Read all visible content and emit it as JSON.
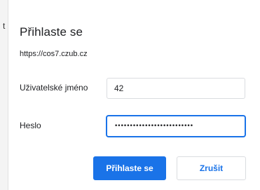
{
  "dialog": {
    "title": "Přihlaste se",
    "url": "https://cos7.czub.cz",
    "stray_mark": "t",
    "username": {
      "label": "Uživatelské jméno",
      "value": "42"
    },
    "password": {
      "label": "Heslo",
      "masked_value": "••••••••••••••••••••••••••"
    },
    "buttons": {
      "sign_in": "Přihlaste se",
      "cancel": "Zrušit"
    },
    "colors": {
      "accent": "#1a73e8",
      "text": "#202124",
      "border": "#dadce0"
    }
  }
}
